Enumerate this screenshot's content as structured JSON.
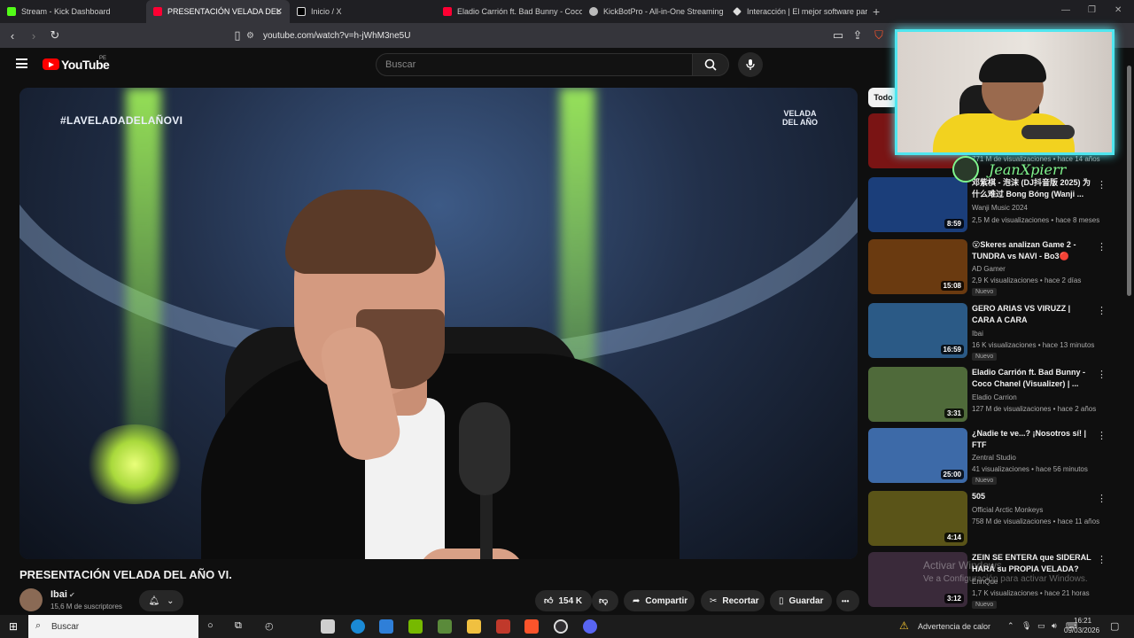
{
  "browser": {
    "tabs": [
      {
        "label": "Stream - Kick Dashboard",
        "color": "#53fc18",
        "active": false
      },
      {
        "label": "PRESENTACIÓN VELADA DEL",
        "color": "#ff0033",
        "active": true
      },
      {
        "label": "Inicio / X",
        "color": "#ffffff",
        "active": false
      },
      {
        "label": "Eladio Carrión ft. Bad Bunny - Coco C",
        "color": "#ff0033",
        "active": false
      },
      {
        "label": "KickBotPro - All-in-One Streaming To",
        "color": "#bbbbbb",
        "active": false
      },
      {
        "label": "Interacción | El mejor software para p",
        "color": "#dddddd",
        "active": false
      }
    ],
    "tab_close": "✕",
    "new_tab": "+",
    "url": "youtube.com/watch?v=h-jWhM3ne5U"
  },
  "youtube": {
    "logo_text": "YouTube",
    "region": "PE",
    "search_placeholder": "Buscar"
  },
  "video": {
    "overlay_hashtag": "#LAVELADADELAÑOVI",
    "overlay_logo": "VELADA DEL AÑO",
    "title": "PRESENTACIÓN VELADA DEL AÑO VI.",
    "channel": "Ibai",
    "subscribers": "15,6 M de suscriptores",
    "likes": "154 K",
    "share": "Compartir",
    "clip": "Recortar",
    "save": "Guardar",
    "more": "•••"
  },
  "sidebar": {
    "chip": "Todo",
    "items": [
      {
        "title": "",
        "channel": "",
        "meta": "771 M de visualizaciones • hace 14 años",
        "duration": "",
        "badge": "",
        "thumb": "#7a1414"
      },
      {
        "title": "邓紫棋 - 泡沫 (DJ抖音版 2025) 为什么难过 Bong Bóng (Wanji ...",
        "channel": "Wanji Music 2024",
        "meta": "2,5 M de visualizaciones • hace 8 meses",
        "duration": "8:59",
        "badge": "",
        "thumb": "#1b3e7a"
      },
      {
        "title": "😮Skeres analizan  Game 2 - TUNDRA vs NAVI - Bo3🔴 PGL...",
        "channel": "AD Gamer",
        "meta": "2,9 K visualizaciones • hace 2 días",
        "duration": "15:08",
        "badge": "Nuevo",
        "thumb": "#6a3a10"
      },
      {
        "title": "GERO ARIAS VS VIRUZZ | CARA A CARA",
        "channel": "Ibai",
        "meta": "16 K visualizaciones • hace 13 minutos",
        "duration": "16:59",
        "badge": "Nuevo",
        "thumb": "#2b5a86"
      },
      {
        "title": "Eladio Carrión ft. Bad Bunny - Coco Chanel (Visualizer) | ...",
        "channel": "Eladio Carrion",
        "meta": "127 M de visualizaciones • hace 2 años",
        "duration": "3:31",
        "badge": "",
        "thumb": "#4f6a3a"
      },
      {
        "title": "¿Nadie te ve...? ¡Nosotros sí! | FTF",
        "channel": "Zentral Studio",
        "meta": "41 visualizaciones • hace 56 minutos",
        "duration": "25:00",
        "badge": "Nuevo",
        "thumb": "#3d6aa8"
      },
      {
        "title": "505",
        "channel": "Official Arctic Monkeys",
        "meta": "758 M de visualizaciones • hace 11 años",
        "duration": "4:14",
        "badge": "",
        "thumb": "#5a5418"
      },
      {
        "title": "ZEIN SE ENTERA que SIDERAL HARÁ su PROPIA VELADA?",
        "channel": "EnnQue",
        "meta": "1,7 K visualizaciones • hace 21 horas",
        "duration": "3:12",
        "badge": "Nuevo",
        "thumb": "#3a2a3a"
      }
    ]
  },
  "webcam": {
    "name": "JeanXpierr"
  },
  "watermark": {
    "line1": "Activar Windows",
    "line2": "Ve a Configuración para activar Windows."
  },
  "taskbar": {
    "search": "Buscar",
    "weather": "Advertencia de calor",
    "time": "16:21",
    "date": "09/03/2026"
  }
}
